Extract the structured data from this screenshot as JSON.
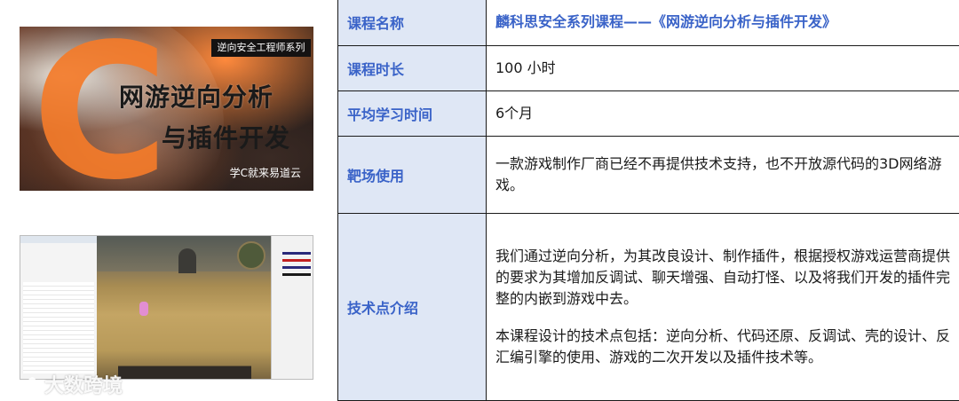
{
  "cover": {
    "tag": "逆向安全工程师系列",
    "letter": "C",
    "title_line1": "网游逆向分析",
    "title_line2": "与插件开发",
    "brand": "学C就来易道云"
  },
  "table": {
    "rows": [
      {
        "label": "课程名称",
        "value": "麟科思安全系列课程——《网游逆向分析与插件开发》"
      },
      {
        "label": "课程时长",
        "value": "100 小时"
      },
      {
        "label": "平均学习时间",
        "value": "6个月"
      },
      {
        "label": "靶场使用",
        "value": "一款游戏制作厂商已经不再提供技术支持，也不开放源代码的3D网络游戏。"
      },
      {
        "label": "技术点介绍",
        "paragraphs": [
          "我们通过逆向分析，为其改良设计、制作插件，根据授权游戏运营商提供的要求为其增加反调试、聊天增强、自动打怪、以及将我们开发的插件完整的内嵌到游戏中去。",
          "本课程设计的技术点包括：逆向分析、代码还原、反调试、壳的设计、反汇编引擎的使用、游戏的二次开发以及插件技术等。"
        ]
      }
    ]
  },
  "watermark": "大数跨境",
  "colors": {
    "label_bg": "#dfe7f5",
    "label_text": "#3a63c8",
    "accent_orange": "#f47b2a"
  }
}
